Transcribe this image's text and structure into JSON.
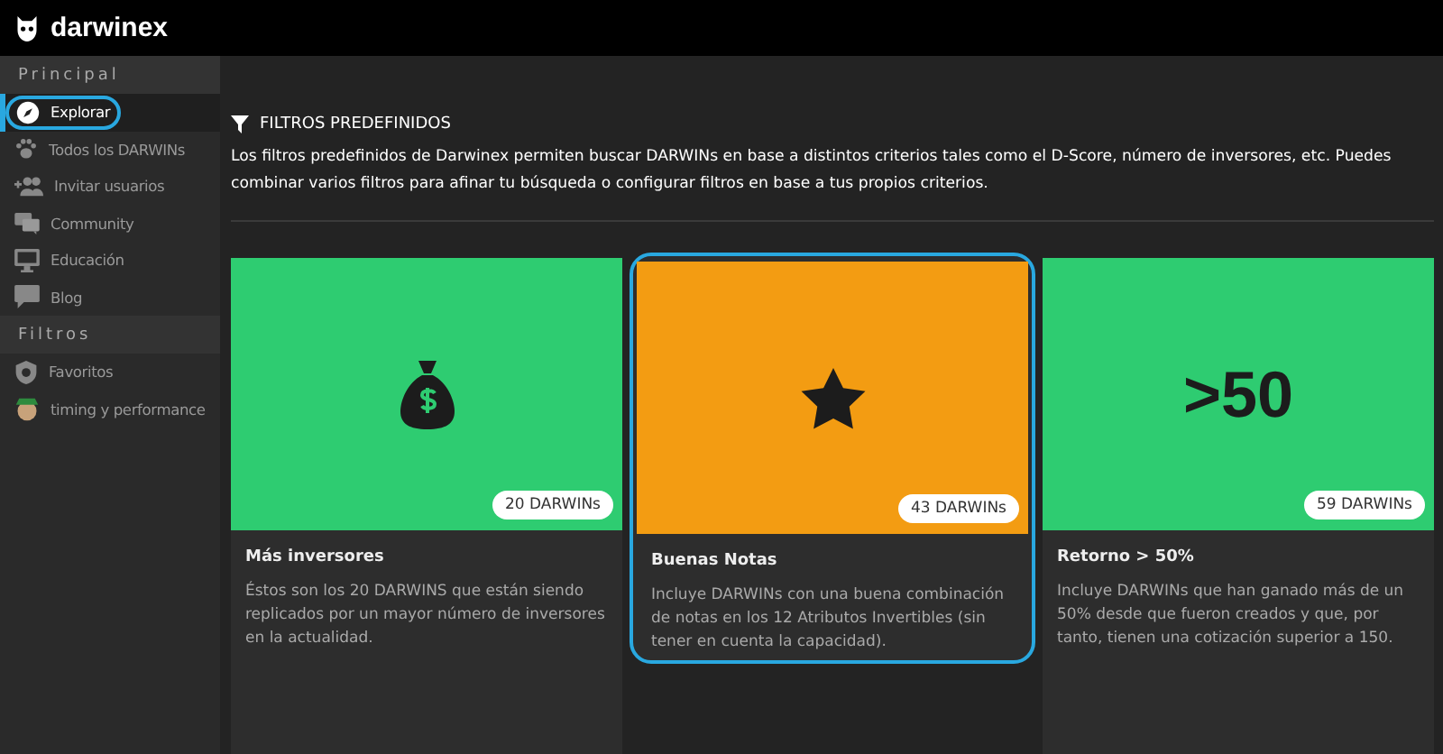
{
  "header": {
    "brand": "darwinex"
  },
  "sidebar": {
    "sections": [
      {
        "title": "Principal",
        "items": [
          {
            "label": "Explorar",
            "kind": "compass",
            "selected": true
          },
          {
            "label": "Todos los DARWINs",
            "kind": "paw",
            "selected": false
          },
          {
            "label": "Invitar usuarios",
            "kind": "add-users",
            "selected": false
          },
          {
            "label": "Community",
            "kind": "chat",
            "selected": false
          },
          {
            "label": "Educación",
            "kind": "monitor",
            "selected": false
          },
          {
            "label": "Blog",
            "kind": "comment",
            "selected": false
          }
        ]
      },
      {
        "title": "Filtros",
        "items": [
          {
            "label": "Favoritos",
            "kind": "shield",
            "selected": false
          },
          {
            "label": "timing y performance",
            "kind": "avatar",
            "selected": false
          }
        ]
      }
    ]
  },
  "intro": {
    "title": "FILTROS PREDEFINIDOS",
    "text": "Los filtros predefinidos de Darwinex permiten buscar DARWINs en base a distintos criterios tales como el D-Score, número de inversores, etc. Puedes combinar varios filtros para afinar tu búsqueda o configurar filtros en base a tus propios criterios."
  },
  "cards": [
    {
      "kind": "money-bag",
      "color": "#2ecc71",
      "highlighted": false,
      "count": "20 DARWINs",
      "title": "Más inversores",
      "description": "Éstos son los 20 DARWINS que están siendo replicados por un mayor número de inversores en la actualidad."
    },
    {
      "kind": "star",
      "color": "#f39c12",
      "highlighted": true,
      "count": "43 DARWINs",
      "title": "Buenas Notas",
      "description": "Incluye DARWINs con una buena combinación de notas en los 12 Atributos Invertibles (sin tener en cuenta la capacidad)."
    },
    {
      "kind": "text",
      "art_text": ">50",
      "color": "#2ecc71",
      "highlighted": false,
      "count": "59 DARWINs",
      "title": "Retorno > 50%",
      "description": "Incluye DARWINs que han ganado más de un 50% desde que fueron creados y que, por tanto, tienen una cotización superior a 150."
    }
  ]
}
